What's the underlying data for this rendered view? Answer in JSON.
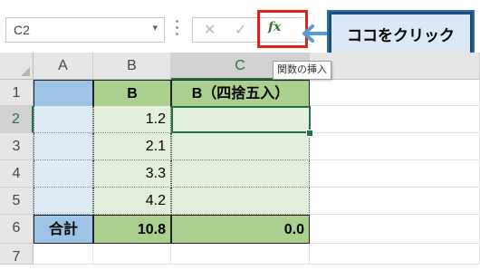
{
  "formula_bar": {
    "name_box": "C2",
    "name_box_caret": "▾",
    "cancel_symbol": "✕",
    "enter_symbol": "✓",
    "fx_symbol": "fx",
    "fx_tooltip": "関数の挿入"
  },
  "callout": {
    "text": "ココをクリック",
    "accent": "#e02020",
    "arrow_color": "#5b9bd5"
  },
  "columns": [
    "A",
    "B",
    "C"
  ],
  "rows": [
    {
      "num": "1",
      "A": "",
      "B": "B",
      "C": "B（四捨五入）"
    },
    {
      "num": "2",
      "A": "",
      "B": "1.2",
      "C": ""
    },
    {
      "num": "3",
      "A": "",
      "B": "2.1",
      "C": ""
    },
    {
      "num": "4",
      "A": "",
      "B": "3.3",
      "C": ""
    },
    {
      "num": "5",
      "A": "",
      "B": "4.2",
      "C": ""
    },
    {
      "num": "6",
      "A": "合計",
      "B": "10.8",
      "C": "0.0"
    },
    {
      "num": "7",
      "A": "",
      "B": "",
      "C": ""
    }
  ],
  "selection": {
    "cell": "C2",
    "row": "2",
    "column": "C"
  }
}
